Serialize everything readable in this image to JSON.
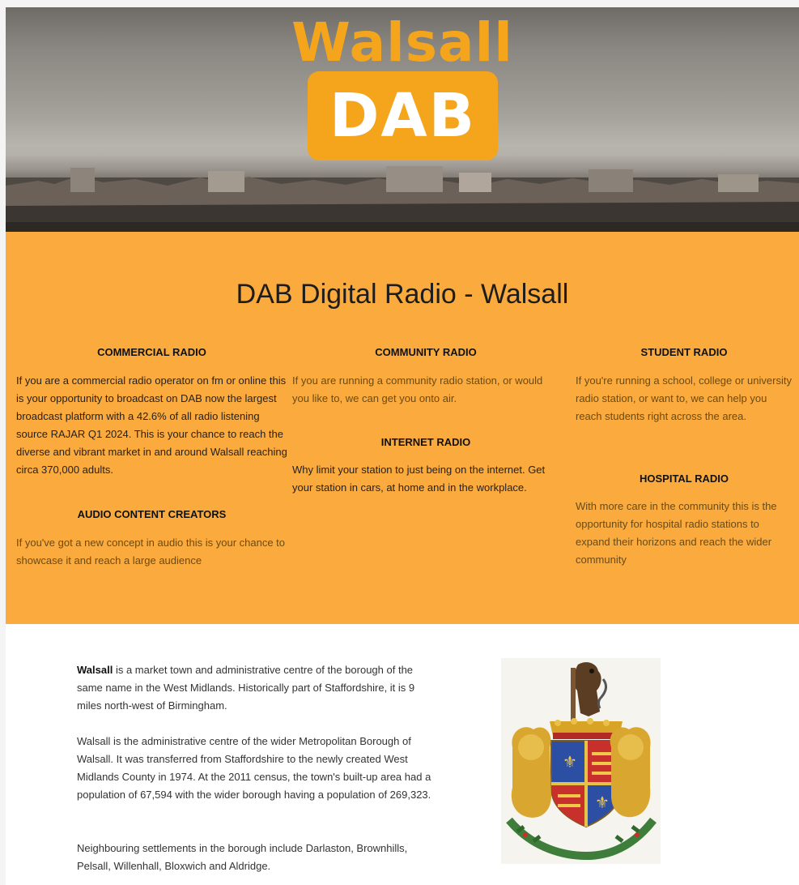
{
  "hero": {
    "logo_top": "Walsall",
    "logo_box": "DAB"
  },
  "heading": "DAB Digital Radio - Walsall",
  "columns": [
    {
      "sections": [
        {
          "title": "COMMERCIAL RADIO",
          "text": "If you are a commercial radio operator on fm or online this is your opportunity to broadcast on DAB now the largest broadcast platform with a 42.6% of all radio listening source RAJAR Q1 2024.  This is your chance to reach the diverse and vibrant market in and around Walsall  reaching circa 370,000 adults."
        },
        {
          "title": "AUDIO CONTENT CREATORS",
          "text": "If you've got a new concept in audio this is your chance  to showcase it and reach a large audience"
        }
      ]
    },
    {
      "sections": [
        {
          "title": "COMMUNITY RADIO",
          "text": "If you are running a community radio station, or would you like to, we can get you onto air."
        },
        {
          "title": "INTERNET RADIO",
          "text": "Why limit your station to just being on the internet. Get your station in cars, at home and in the workplace."
        }
      ]
    },
    {
      "sections": [
        {
          "title": "STUDENT RADIO",
          "text": "If you're running a school, college or university radio station, or want to, we can help you reach students right across the area."
        },
        {
          "title": "HOSPITAL RADIO",
          "text": "With more care in the community this is the opportunity for hospital radio stations to expand their horizons and reach the wider community"
        }
      ]
    }
  ],
  "about": {
    "p1_bold": "Walsall",
    "p1_rest": " is a market town and administrative centre of the borough of the same name in the West Midlands.  Historically part of Staffordshire, it is 9 miles north-west of Birmingham.",
    "p2": "Walsall is the administrative centre of the wider Metropolitan Borough of Walsall. It was transferred from Staffordshire to the newly created West Midlands County in 1974. At the 2011 census, the town's built-up area had a population of 67,594 with the wider borough having a population of 269,323.",
    "p3": "Neighbouring settlements in the borough include Darlaston, Brownhills, Pelsall, Willenhall, Bloxwich and Aldridge."
  },
  "colors": {
    "accent": "#f4a51c",
    "band": "#fbab3d"
  },
  "icons": {
    "crest": "walsall-coat-of-arms"
  }
}
